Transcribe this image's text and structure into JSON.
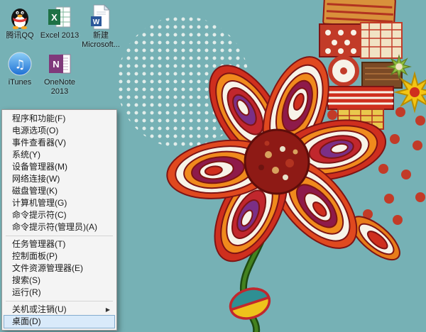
{
  "colors": {
    "desktop_background": "#76b1b5",
    "menu_background": "#f4f4f4",
    "menu_highlight": "#d9eafa",
    "menu_highlight_border": "#84acce",
    "flower_red": "#cf2f1e",
    "flower_orange": "#f08a1d",
    "flower_center": "#8e1a15"
  },
  "desktop": {
    "icons": [
      {
        "name": "qq",
        "label": "腾讯QQ"
      },
      {
        "name": "excel",
        "label": "Excel 2013",
        "glyph": "X"
      },
      {
        "name": "word-doc",
        "label": "新建 Microsoft...",
        "glyph": "W"
      },
      {
        "name": "itunes",
        "label": "iTunes",
        "glyph": "♫"
      },
      {
        "name": "onenote",
        "label": "OneNote 2013",
        "glyph": "N"
      }
    ]
  },
  "menu": {
    "submenu_arrow": "▶",
    "items": [
      {
        "label": "程序和功能(F)"
      },
      {
        "label": "电源选项(O)"
      },
      {
        "label": "事件查看器(V)"
      },
      {
        "label": "系统(Y)"
      },
      {
        "label": "设备管理器(M)"
      },
      {
        "label": "网络连接(W)"
      },
      {
        "label": "磁盘管理(K)"
      },
      {
        "label": "计算机管理(G)"
      },
      {
        "label": "命令提示符(C)"
      },
      {
        "label": "命令提示符(管理员)(A)"
      },
      {
        "label": "任务管理器(T)"
      },
      {
        "label": "控制面板(P)"
      },
      {
        "label": "文件资源管理器(E)"
      },
      {
        "label": "搜索(S)"
      },
      {
        "label": "运行(R)"
      },
      {
        "label": "关机或注销(U)",
        "has_submenu": true
      },
      {
        "label": "桌面(D)",
        "selected": true
      }
    ]
  }
}
